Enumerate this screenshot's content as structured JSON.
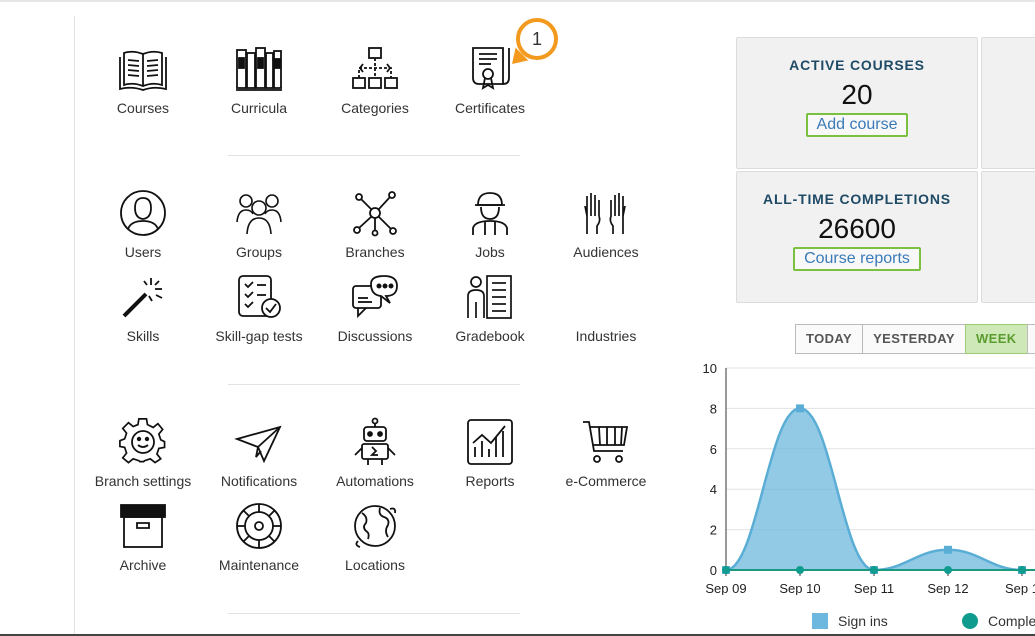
{
  "menu": {
    "row1": [
      "Courses",
      "Curricula",
      "Categories",
      "Certificates"
    ],
    "row2": [
      "Users",
      "Groups",
      "Branches",
      "Jobs",
      "Audiences"
    ],
    "row3": [
      "Skills",
      "Skill-gap tests",
      "Discussions",
      "Gradebook",
      "Industries"
    ],
    "row4": [
      "Branch settings",
      "Notifications",
      "Automations",
      "Reports",
      "e-Commerce"
    ],
    "row5": [
      "Archive",
      "Maintenance",
      "Locations"
    ]
  },
  "badge": {
    "number": "1",
    "color": "#f39a1e"
  },
  "stats": {
    "active_courses": {
      "title": "ACTIVE COURSES",
      "value": "20",
      "button": "Add course"
    },
    "completions": {
      "title": "ALL-TIME COMPLETIONS",
      "value": "26600",
      "button": "Course reports"
    }
  },
  "period_tabs": [
    "TODAY",
    "YESTERDAY",
    "WEEK"
  ],
  "active_period": "WEEK",
  "chart_data": {
    "type": "area",
    "x": [
      "Sep 09",
      "Sep 10",
      "Sep 11",
      "Sep 12",
      "Sep 1"
    ],
    "ylim": [
      0,
      10
    ],
    "yticks": [
      "0",
      "2",
      "4",
      "6",
      "8",
      "10"
    ],
    "series": [
      {
        "name": "Sign ins",
        "values": [
          0,
          8,
          0,
          1,
          0
        ],
        "color": "#6db8de"
      },
      {
        "name": "Complet",
        "values": [
          0,
          0,
          0,
          0,
          0
        ],
        "color": "#0f9b8e"
      }
    ],
    "grid": true,
    "legend": "bottom"
  }
}
